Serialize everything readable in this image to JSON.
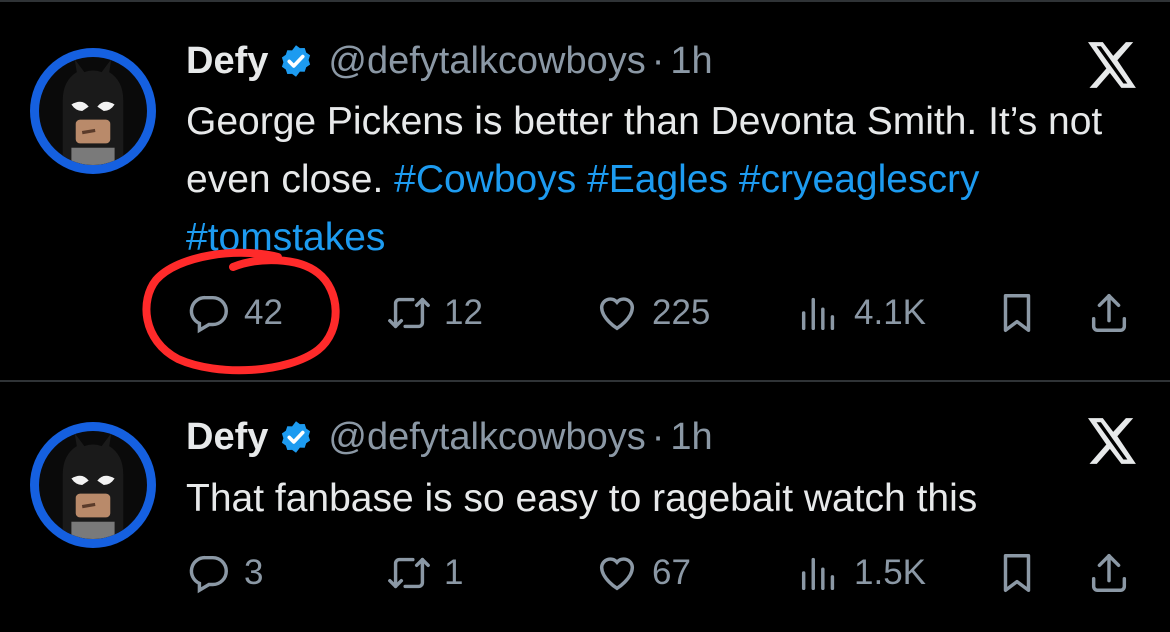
{
  "tweets": [
    {
      "name": "Defy",
      "handle": "@defytalkcowboys",
      "separator": "·",
      "time": "1h",
      "text_plain": "George Pickens is better than Devonta Smith. It’s not even close. ",
      "hashtags": [
        "#Cowboys",
        "#Eagles",
        "#cryeaglescry",
        "#tomstakes"
      ],
      "replies": "42",
      "reposts": "12",
      "likes": "225",
      "views": "4.1K"
    },
    {
      "name": "Defy",
      "handle": "@defytalkcowboys",
      "separator": "·",
      "time": "1h",
      "text_plain": "That fanbase is so easy to ragebait watch this",
      "hashtags": [],
      "replies": "3",
      "reposts": "1",
      "likes": "67",
      "views": "1.5K"
    }
  ],
  "icons": {
    "verified": "verified-badge-icon",
    "brand": "x-logo-icon",
    "reply": "reply-icon",
    "repost": "repost-icon",
    "like": "heart-icon",
    "views": "views-icon",
    "bookmark": "bookmark-icon",
    "share": "share-icon"
  },
  "colors": {
    "background": "#000000",
    "text": "#e7e9ea",
    "muted": "#8b98a5",
    "link": "#1d9bf0",
    "verified": "#1d9bf0",
    "avatar_ring": "#1560e0",
    "annotation": "#ff2a2a"
  }
}
